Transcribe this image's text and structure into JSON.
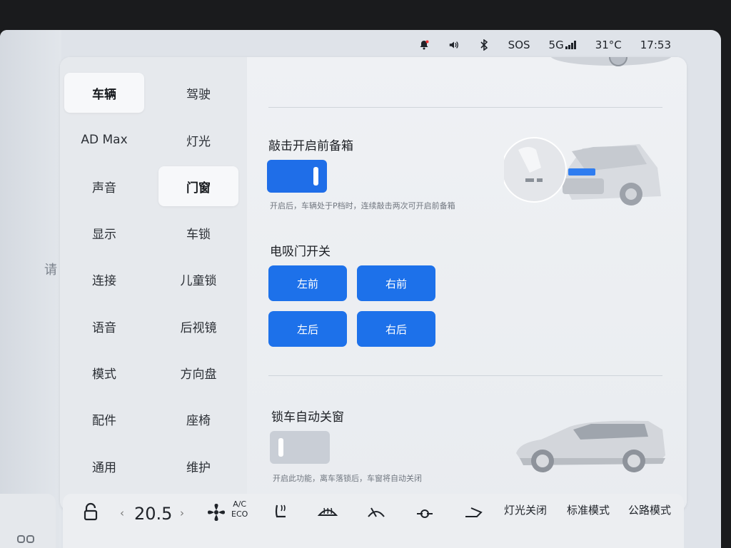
{
  "status_bar": {
    "sos": "SOS",
    "network": "5G",
    "temperature": "31°C",
    "time": "17:53"
  },
  "left_hint": "请",
  "nav": [
    {
      "label": "车辆",
      "active": true
    },
    {
      "label": "驾驶",
      "active": false
    },
    {
      "label": "AD Max",
      "active": false
    },
    {
      "label": "灯光",
      "active": false
    },
    {
      "label": "声音",
      "active": false
    },
    {
      "label": "门窗",
      "active": true
    },
    {
      "label": "显示",
      "active": false
    },
    {
      "label": "车锁",
      "active": false
    },
    {
      "label": "连接",
      "active": false
    },
    {
      "label": "儿童锁",
      "active": false
    },
    {
      "label": "语音",
      "active": false
    },
    {
      "label": "后视镜",
      "active": false
    },
    {
      "label": "模式",
      "active": false
    },
    {
      "label": "方向盘",
      "active": false
    },
    {
      "label": "配件",
      "active": false
    },
    {
      "label": "座椅",
      "active": false
    },
    {
      "label": "通用",
      "active": false
    },
    {
      "label": "维护",
      "active": false
    }
  ],
  "frunk": {
    "title": "敲击开启前备箱",
    "enabled": true,
    "hint": "开启后，车辆处于P档时，连续敲击两次可开启前备箱"
  },
  "soft_close": {
    "title": "电吸门开关",
    "buttons": {
      "front_left": "左前",
      "front_right": "右前",
      "rear_left": "左后",
      "rear_right": "右后"
    }
  },
  "auto_window": {
    "title": "锁车自动关窗",
    "enabled": false,
    "hint": "开启此功能，离车落锁后，车窗将自动关闭"
  },
  "dock": {
    "temperature_value": "20.5",
    "ac_label": "A/C",
    "eco_label": "ECO",
    "lights_off": "灯光关闭",
    "standard_mode": "标准模式",
    "road_mode": "公路模式"
  },
  "colors": {
    "accent_blue": "#1d71ea",
    "toggle_off": "#c9ced6"
  }
}
